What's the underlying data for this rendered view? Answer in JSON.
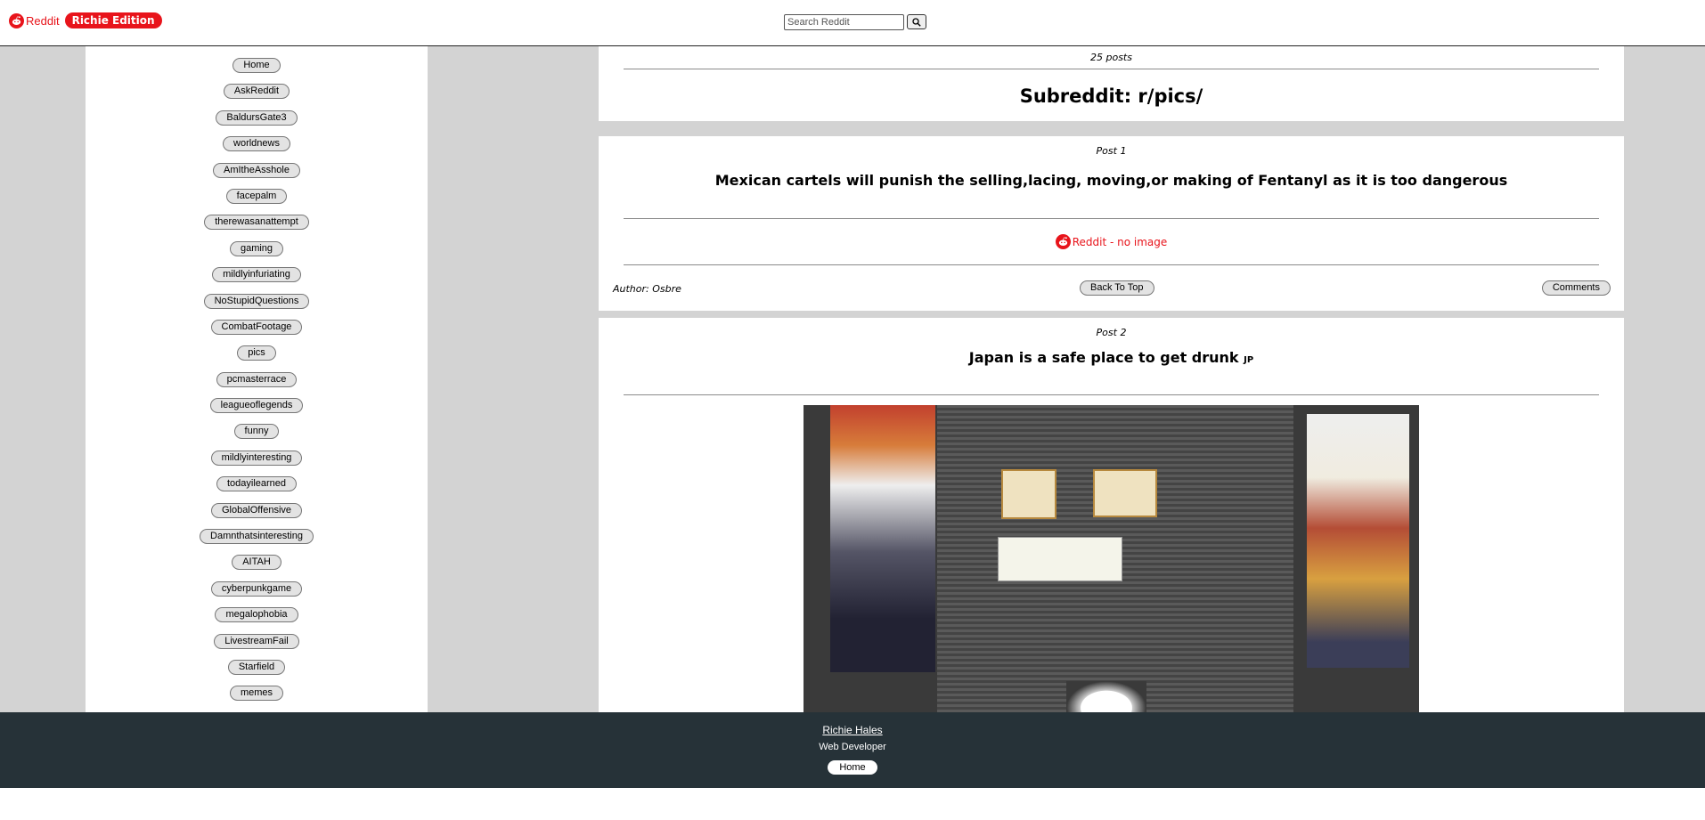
{
  "header": {
    "logo_text": "Reddit",
    "edition_badge": "Richie Edition",
    "search_placeholder": "Search Reddit"
  },
  "sidebar": {
    "items": [
      "Home",
      "AskReddit",
      "BaldursGate3",
      "worldnews",
      "AmItheAsshole",
      "facepalm",
      "therewasanattempt",
      "gaming",
      "mildlyinfuriating",
      "NoStupidQuestions",
      "CombatFootage",
      "pics",
      "pcmasterrace",
      "leagueoflegends",
      "funny",
      "mildlyinteresting",
      "todayilearned",
      "GlobalOffensive",
      "Damnthatsinteresting",
      "AITAH",
      "cyberpunkgame",
      "megalophobia",
      "LivestreamFail",
      "Starfield",
      "memes"
    ]
  },
  "subreddit": {
    "post_count": "25 posts",
    "title": "Subreddit: r/pics/"
  },
  "posts": [
    {
      "label": "Post 1",
      "title": "Mexican cartels will punish the selling,lacing, moving,or making of Fentanyl as it is too dangerous",
      "no_image_text": "Reddit - no image",
      "author": "Author: Osbre",
      "back_to_top": "Back To Top",
      "comments": "Comments"
    },
    {
      "label": "Post 2",
      "title": "Japan is a safe place to get drunk",
      "flair": "JP"
    }
  ],
  "footer": {
    "name": "Richie Hales",
    "role": "Web Developer",
    "home": "Home"
  },
  "colors": {
    "brand_red": "#e8141b",
    "footer_bg": "#263238",
    "page_bg": "#d3d3d3"
  }
}
